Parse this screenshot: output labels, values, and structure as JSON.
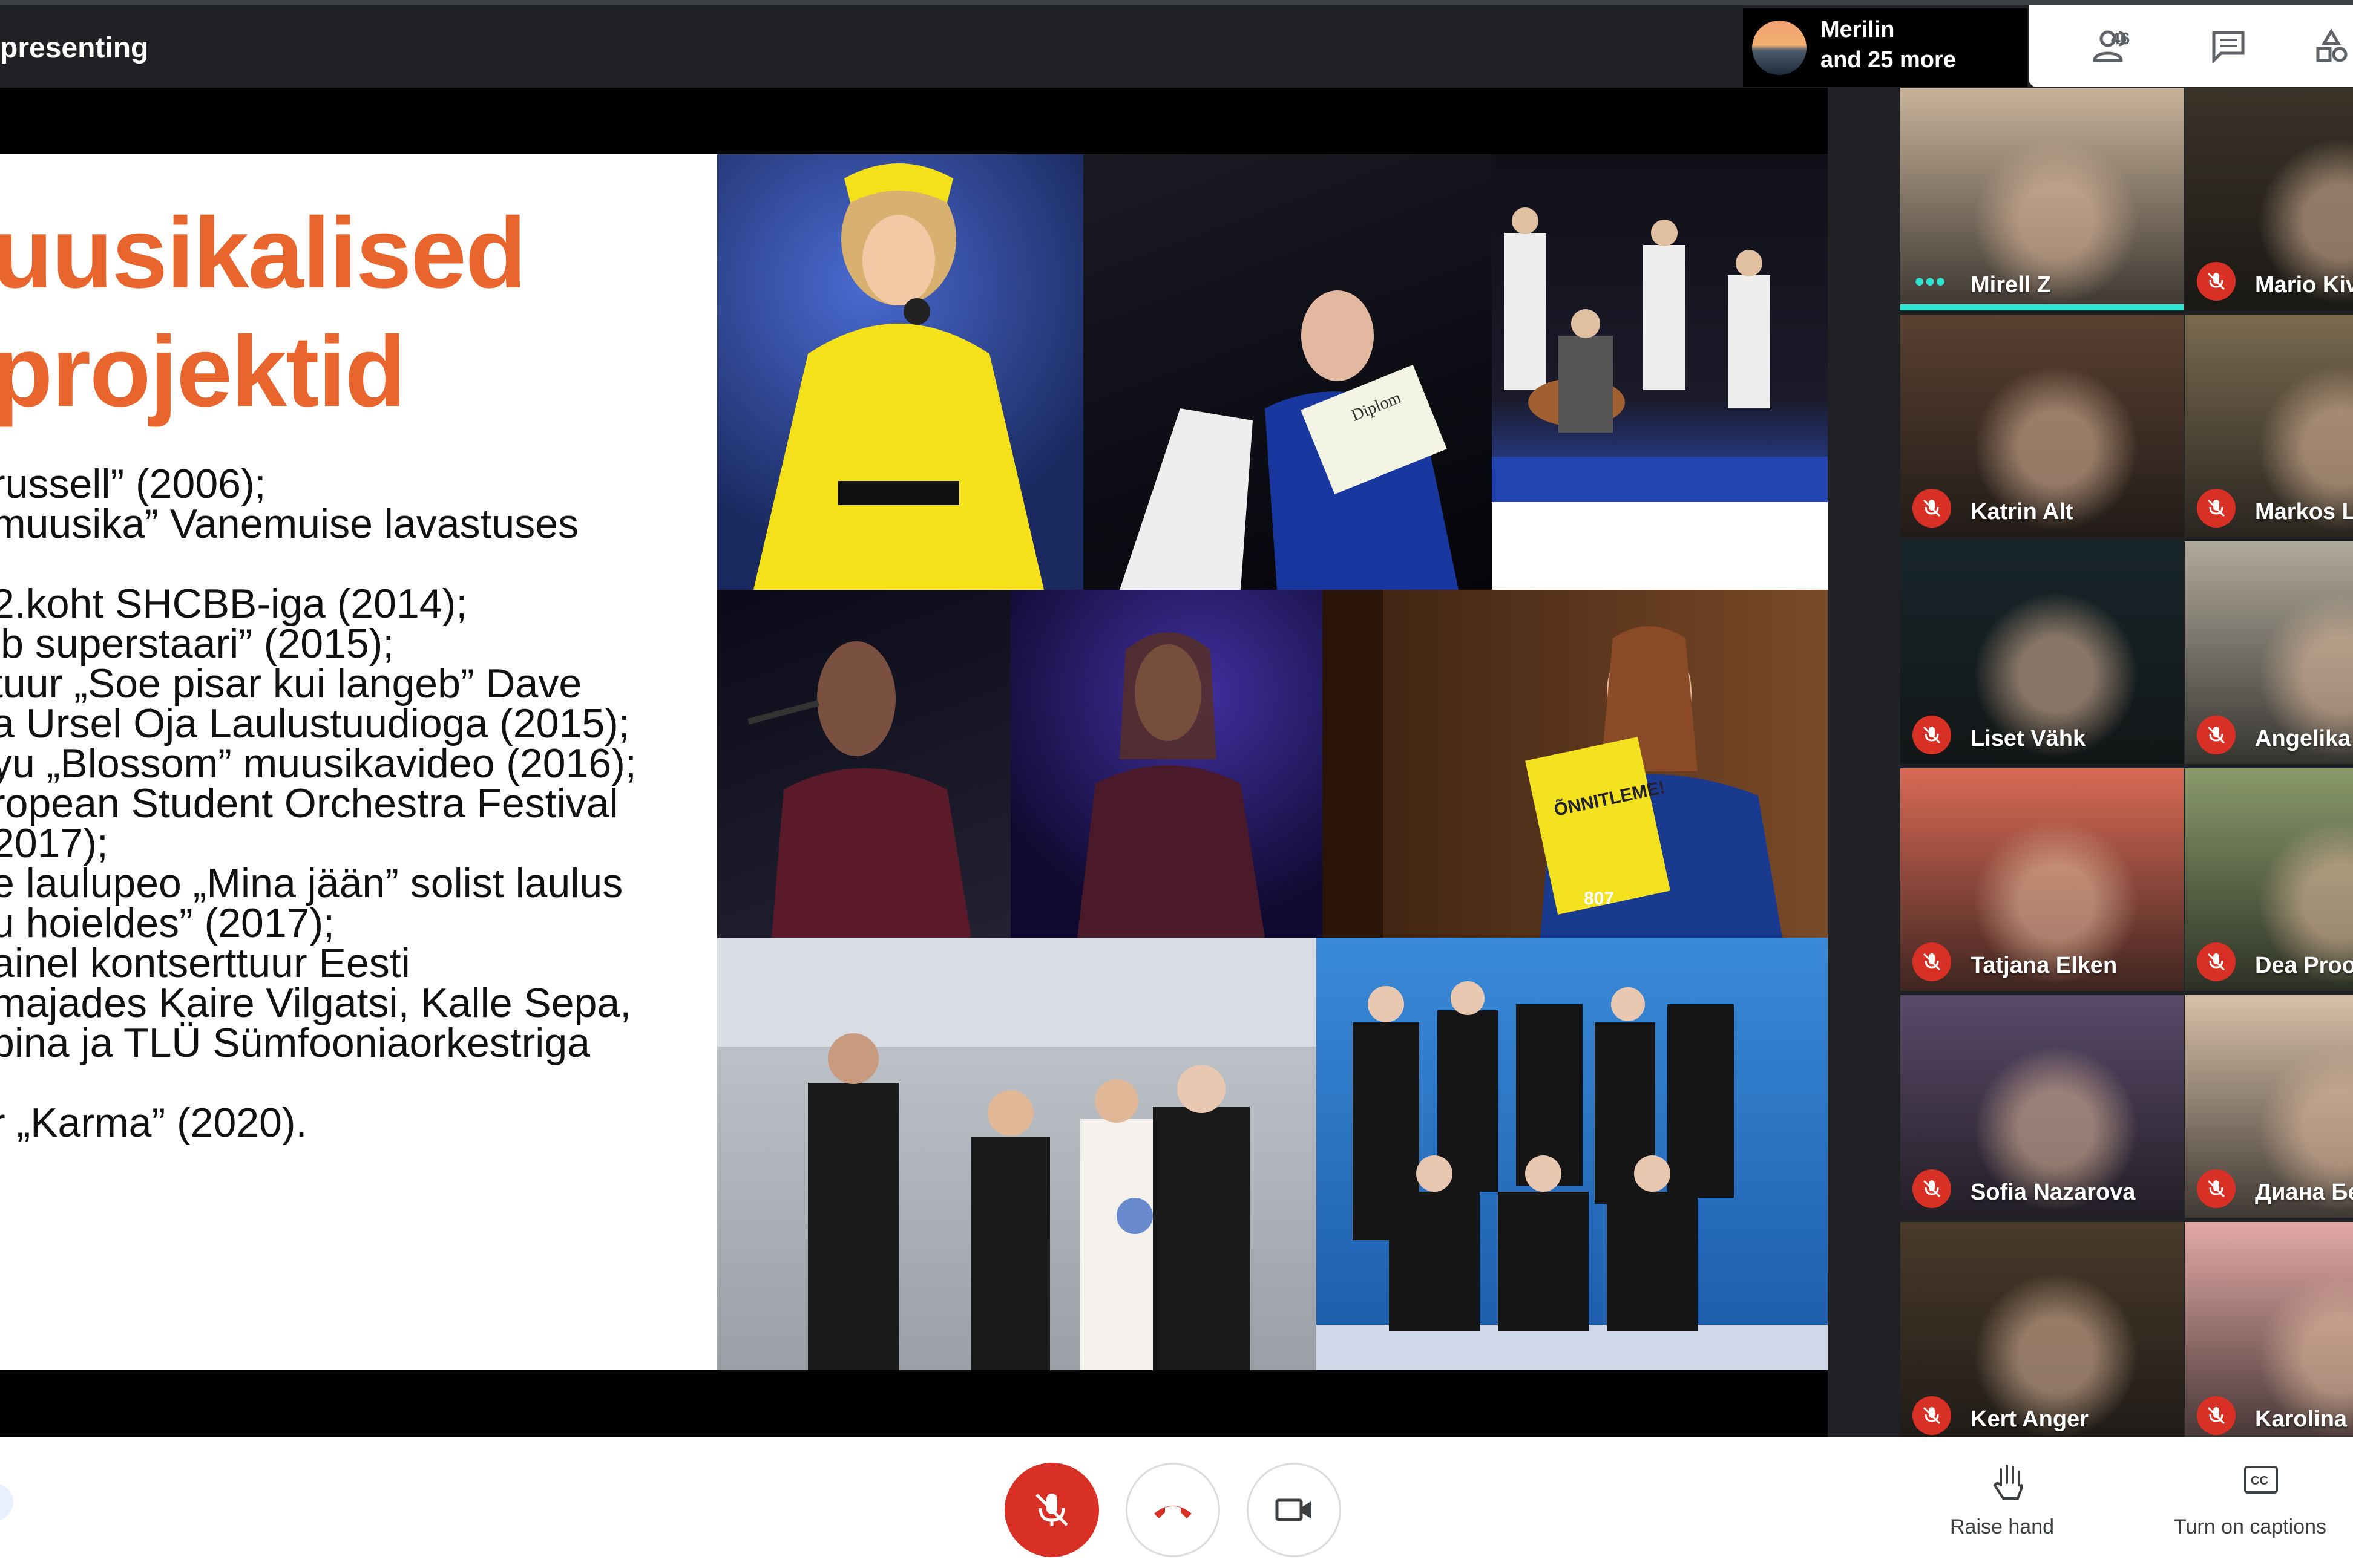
{
  "header": {
    "presenting_label": "presenting",
    "presenter": {
      "name": "Merilin",
      "more": "and 25 more"
    },
    "people_count": "46"
  },
  "slide": {
    "title_line1": "uusikalised",
    "title_line2": "projektid",
    "body_lines": [
      "russell” (2006);",
      "muusika” Vanemuise lavastuses",
      "",
      "2.koht SHCBB-iga (2014);",
      "ib superstaari” (2015);",
      "tuur „Soe pisar kui langeb” Dave",
      "a Ursel Oja Laulustuudioga (2015);",
      "yu „Blossom” muusikavideo (2016);",
      "ropean Student Orchestra Festival",
      "2017);",
      "e laulupeo „Mina jään” solist laulus",
      "u hoieldes” (2017);",
      "ainel kontserttuur Eesti",
      "majades Kaire Vilgatsi, Kalle Sepa,",
      "pina ja TLÜ Sümfooniaorkestriga",
      "",
      "r „Karma” (2020)."
    ],
    "photo_texts": {
      "diploma": "Diplom",
      "congrats_sign": "ÕNNITLEME!",
      "contestant_number": "807"
    }
  },
  "participants": [
    {
      "name": "Mirell Z",
      "muted": false,
      "speaking": true,
      "bg": "#c9b39a"
    },
    {
      "name": "Mario Kiv",
      "muted": true,
      "bg": "#3a3328"
    },
    {
      "name": "Katrin Alt",
      "muted": true,
      "bg": "#5a4030"
    },
    {
      "name": "Markos L",
      "muted": true,
      "bg": "#7a6a50"
    },
    {
      "name": "Liset Vähk",
      "muted": true,
      "bg": "#18262a"
    },
    {
      "name": "Angelika",
      "muted": true,
      "bg": "#b0aa9a"
    },
    {
      "name": "Tatjana Elken",
      "muted": true,
      "bg": "#d96a55"
    },
    {
      "name": "Dea Proo",
      "muted": true,
      "bg": "#8a9a6a"
    },
    {
      "name": "Sofia Nazarova",
      "muted": true,
      "bg": "#5a4a6a"
    },
    {
      "name": "Диана Бе",
      "muted": true,
      "bg": "#d8c0a8"
    },
    {
      "name": "Kert Anger",
      "muted": true,
      "bg": "#4a3a2a"
    },
    {
      "name": "Karolina U",
      "muted": true,
      "bg": "#e3a9a5"
    }
  ],
  "controls": {
    "raise_hand": "Raise hand",
    "captions": "Turn on captions"
  },
  "colors": {
    "accent": "#e8662e",
    "mute_red": "#d93025",
    "speaking": "#2ee6cf"
  }
}
